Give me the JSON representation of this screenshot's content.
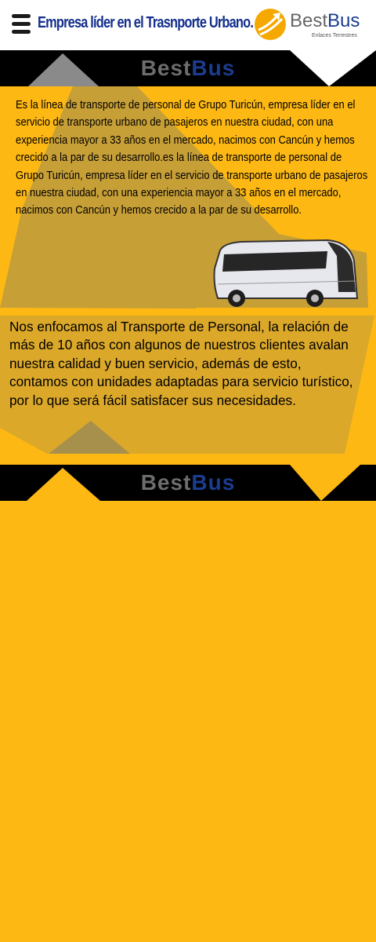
{
  "header": {
    "tagline": "Empresa líder en el Trasnporte Urbano.",
    "logo": {
      "name_part1": "Best",
      "name_part2": "Bus",
      "subtitle": "Enlaces Terrestres"
    }
  },
  "section1": {
    "band_title_part1": "Best",
    "band_title_part2": "Bus",
    "paragraph": "Es la línea de transporte de personal de Grupo Turicún, empresa líder en el servicio de transporte urbano de pasajeros en nuestra ciudad, con una experiencia mayor a 33 años en el mercado, nacimos con Cancún y hemos crecido a la par de su desarrollo.es la línea de transporte de personal de Grupo Turicún, empresa líder en el servicio de transporte urbano de pasajeros en nuestra ciudad, con una experiencia mayor a 33 años en el mercado, nacimos con Cancún y hemos crecido a la par de su desarrollo.",
    "paragraph2": "Nos enfocamos al Transporte de Personal, la relación de más de 10 años con algunos de nuestros clientes avalan nuestra calidad y buen servicio, además de esto, contamos con unidades adaptadas para servicio turístico, por lo que será fácil satisfacer sus necesidades."
  },
  "section2": {
    "band_title_part1": "Best",
    "band_title_part2": "Bus"
  },
  "colors": {
    "background": "#FDB813",
    "band": "#000000",
    "brand_blue": "#1a3d8f",
    "brand_grey": "#6d6d6d",
    "tagline": "#132f8c"
  }
}
